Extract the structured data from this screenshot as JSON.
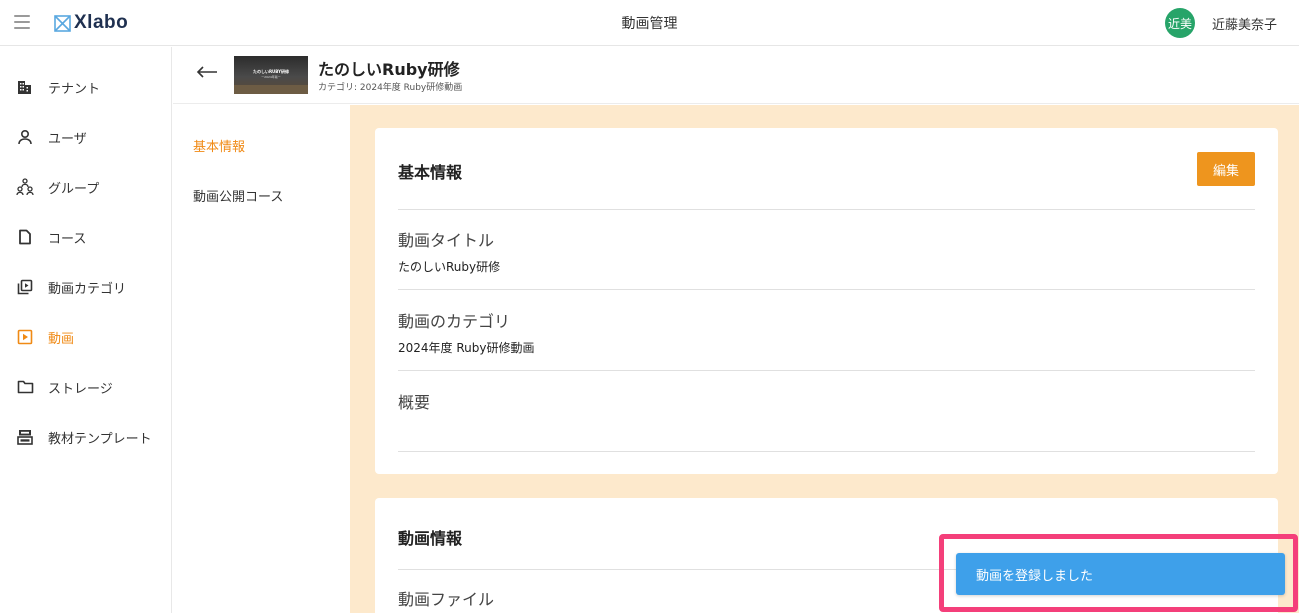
{
  "app": {
    "logo_text": "Xlabo",
    "page_title": "動画管理"
  },
  "user": {
    "avatar_text": "近美",
    "name": "近藤美奈子"
  },
  "sidebar": {
    "items": [
      {
        "label": "テナント",
        "icon": "building-icon"
      },
      {
        "label": "ユーザ",
        "icon": "user-icon"
      },
      {
        "label": "グループ",
        "icon": "group-icon"
      },
      {
        "label": "コース",
        "icon": "document-icon"
      },
      {
        "label": "動画カテゴリ",
        "icon": "video-library-icon"
      },
      {
        "label": "動画",
        "icon": "play-icon",
        "active": true
      },
      {
        "label": "ストレージ",
        "icon": "folder-icon"
      },
      {
        "label": "教材テンプレート",
        "icon": "template-icon"
      }
    ]
  },
  "content_header": {
    "thumbnail_title": "たのしいRUBY研修",
    "thumbnail_subtitle": "ー2024年版ー",
    "title": "たのしいRuby研修",
    "category": "カテゴリ: 2024年度 Ruby研修動画"
  },
  "subnav": {
    "items": [
      {
        "label": "基本情報",
        "active": true
      },
      {
        "label": "動画公開コース",
        "active": false
      }
    ]
  },
  "basic_info": {
    "title": "基本情報",
    "edit_label": "編集",
    "fields": [
      {
        "label": "動画タイトル",
        "value": "たのしいRuby研修"
      },
      {
        "label": "動画のカテゴリ",
        "value": "2024年度 Ruby研修動画"
      },
      {
        "label": "概要",
        "value": ""
      }
    ]
  },
  "video_info": {
    "title": "動画情報",
    "fields": [
      {
        "label": "動画ファイル"
      }
    ]
  },
  "toast": {
    "message": "動画を登録しました"
  },
  "colors": {
    "accent": "#f08a15",
    "edit_button": "#ee951e",
    "main_background": "#fde9cc",
    "toast": "#3ea0ea",
    "highlight_frame": "#f43f7a",
    "avatar": "#27a469"
  }
}
